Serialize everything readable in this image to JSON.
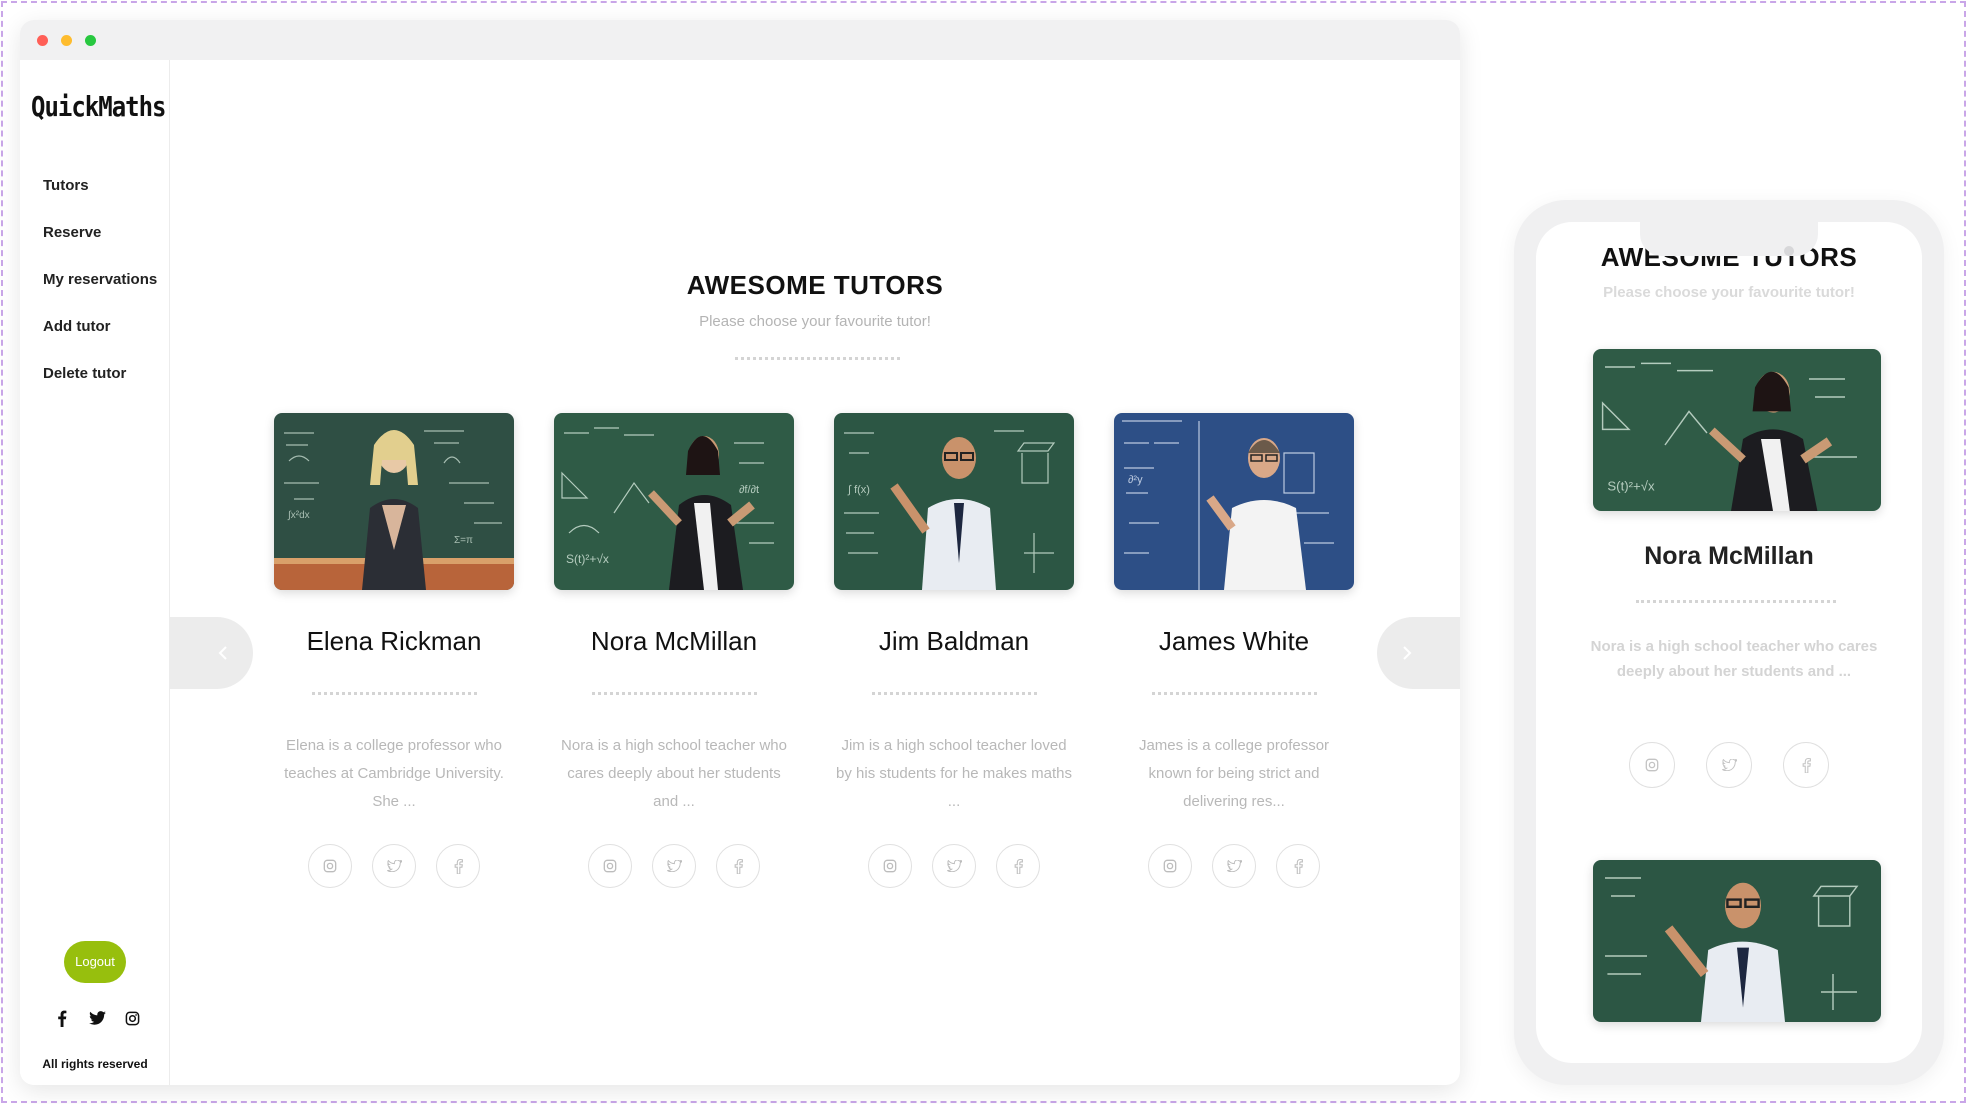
{
  "app": {
    "logo": "QuickMaths",
    "nav": [
      "Tutors",
      "Reserve",
      "My reservations",
      "Add tutor",
      "Delete tutor"
    ],
    "logout_label": "Logout",
    "footer_socials": [
      "facebook-icon",
      "twitter-icon",
      "instagram-icon"
    ],
    "rights": "All rights reserved"
  },
  "main": {
    "title": "AWESOME TUTORS",
    "subtitle": "Please choose your favourite tutor!",
    "prev_icon": "chevron-left-icon",
    "next_icon": "chevron-right-icon",
    "tutors": [
      {
        "name": "Elena Rickman",
        "description": "Elena is a college professor who teaches at Cambridge University. She ...",
        "board": "green-brown"
      },
      {
        "name": "Nora McMillan",
        "description": "Nora is a high school teacher who cares deeply about her students and ...",
        "board": "green"
      },
      {
        "name": "Jim Baldman",
        "description": "Jim is a high school teacher loved by his students for he makes maths ...",
        "board": "green"
      },
      {
        "name": "James White",
        "description": "James is a college professor known for being strict and delivering res...",
        "board": "blue"
      }
    ],
    "card_socials": [
      "instagram-icon",
      "twitter-icon",
      "facebook-icon"
    ]
  },
  "mobile": {
    "title": "AWESOME TUTORS",
    "subtitle": "Please choose your favourite tutor!",
    "tutor": {
      "name": "Nora McMillan",
      "description": "Nora is a high school teacher who cares deeply about her students and ..."
    },
    "next_tutor_photo": "Jim Baldman"
  },
  "colors": {
    "accent": "#97bf0d",
    "chalkboard_green": "#2f5b46",
    "chalkboard_blue": "#2d4f86",
    "muted_text": "#b8b8b8"
  }
}
